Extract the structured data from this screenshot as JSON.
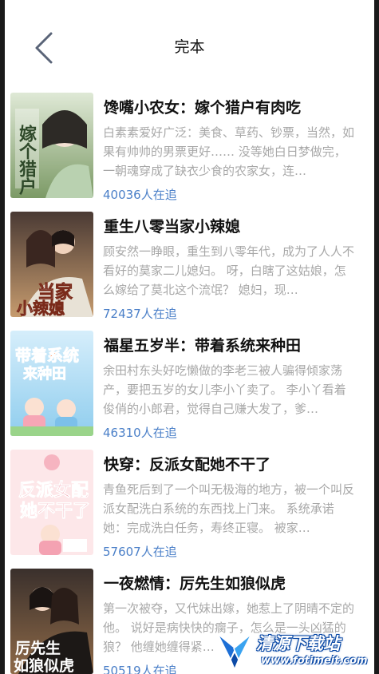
{
  "header": {
    "title": "完本",
    "back_icon": "chevron-left-icon"
  },
  "books": [
    {
      "title": "馋嘴小农女：嫁个猎户有肉吃",
      "description": "白素素爱好广泛：美食、草药、钞票，当然，如果有帅帅的男票更好…… 没等她白日梦做完，一朝魂穿成了缺衣少食的农家女，连…",
      "followers": "40036人在追",
      "cover_text": "嫁个猎户",
      "cover_colors": [
        "#c9d9c0",
        "#6b8a5a"
      ]
    },
    {
      "title": "重生八零当家小辣媳",
      "description": "顾安然一睁眼，重生到八零年代，成为了人人不看好的莫家二儿媳妇。 呀，白瞎了这姑娘，怎么嫁给了莫北这个流氓？ 媳妇，现…",
      "followers": "72437人在追",
      "cover_text": "当家小辣媳",
      "cover_colors": [
        "#3a2d2a",
        "#c89a6a"
      ]
    },
    {
      "title": "福星五岁半：带着系统来种田",
      "description": "余田村东头好吃懒做的李老三被人骗得倾家荡产，要把五岁的女儿李小丫卖了。 李小丫看着俊俏的小郎君，觉得自己赚大发了，爹…",
      "followers": "46310人在追",
      "cover_text": "带着系统来种田",
      "cover_colors": [
        "#bfe3f5",
        "#4aa8de"
      ]
    },
    {
      "title": "快穿：反派女配她不干了",
      "description": "青鱼死后到了一个叫无极海的地方，被一个叫反派女配洗白系统的东西找上门来。 系统承诺她：完成洗白任务，寿终正寝。 被家…",
      "followers": "57607人在追",
      "cover_text": "反派女配她不干了",
      "cover_colors": [
        "#fbe1e3",
        "#f08fa0"
      ]
    },
    {
      "title": "一夜燃情：厉先生如狼似虎",
      "description": "第一次被夺，又代妹出嫁，她惹上了阴晴不定的他。 说好是病快快的瘸子，怎么是一头凶猛的狼？ 他缠她缠得紧…",
      "followers": "50519人在追",
      "cover_text": "厉先生如狼似虎",
      "cover_colors": [
        "#2b2422",
        "#a8825a"
      ]
    }
  ],
  "watermark": {
    "name": "清源下载站",
    "url": "www.fotimeit.com"
  }
}
